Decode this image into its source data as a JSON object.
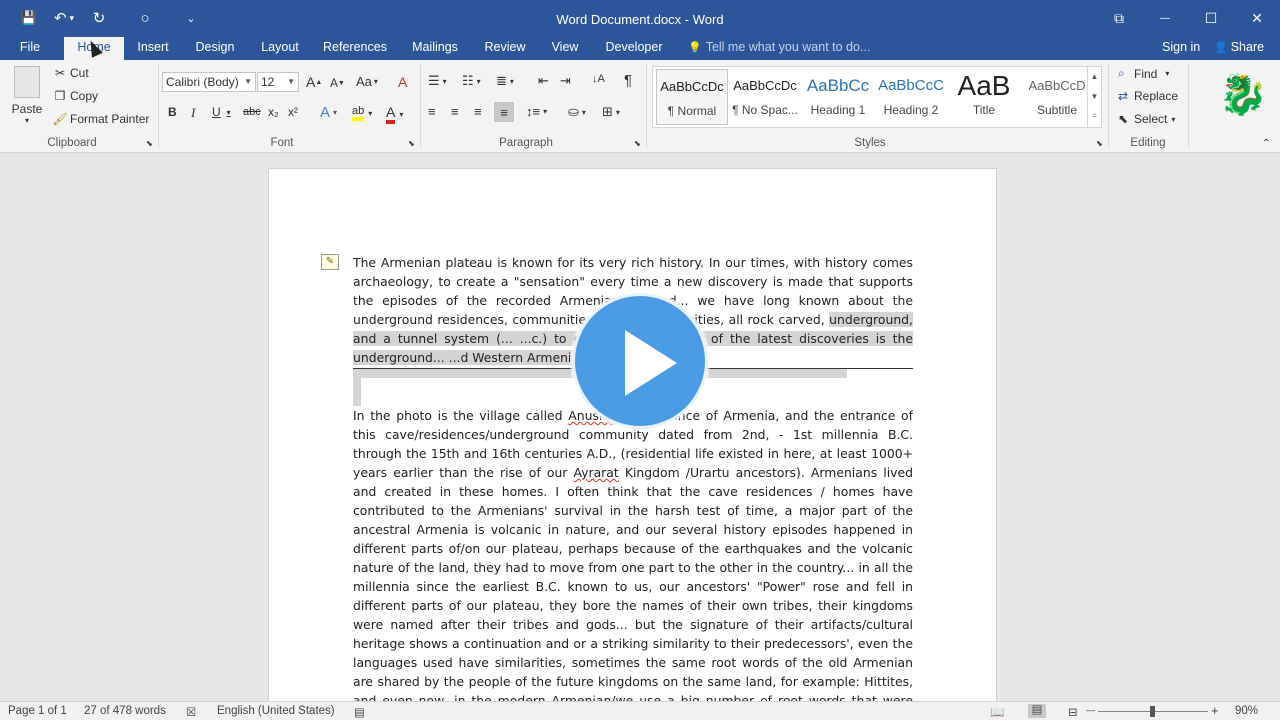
{
  "window": {
    "title": "Word Document.docx - Word"
  },
  "qat": {
    "save": "💾",
    "undo": "↶",
    "undo_dd": "▾",
    "redo": "↻",
    "touch": "○",
    "customize": "⌄"
  },
  "winctl": {
    "ribbon_opts": "⧉",
    "minimize": "—",
    "maximize": "☐",
    "close": "✕"
  },
  "tabs": [
    "File",
    "Home",
    "Insert",
    "Design",
    "Layout",
    "References",
    "Mailings",
    "Review",
    "View",
    "Developer"
  ],
  "tellme": {
    "icon": "💡",
    "placeholder": "Tell me what you want to do..."
  },
  "account": {
    "signin": "Sign in",
    "share": "Share",
    "share_icon": "👤"
  },
  "clipboard": {
    "paste": "Paste",
    "cut": "Cut",
    "copy": "Copy",
    "format_painter": "Format Painter",
    "label": "Clipboard"
  },
  "font": {
    "name": "Calibri (Body)",
    "size": "12",
    "label": "Font",
    "grow": "A",
    "shrink": "A",
    "case": "Aa",
    "clear": "A",
    "bold": "B",
    "italic": "I",
    "underline": "U",
    "strike": "abc",
    "sub": "x₂",
    "sup": "x²",
    "effects": "A",
    "highlight": "ab",
    "color": "A"
  },
  "paragraph": {
    "label": "Paragraph",
    "pilcrow": "¶",
    "sort": "↓A"
  },
  "styles": {
    "label": "Styles",
    "items": [
      {
        "preview": "AaBbCcDc",
        "name": "¶ Normal"
      },
      {
        "preview": "AaBbCcDc",
        "name": "¶ No Spac..."
      },
      {
        "preview": "AaBbCc",
        "name": "Heading 1"
      },
      {
        "preview": "AaBbCcC",
        "name": "Heading 2"
      },
      {
        "preview": "AaB",
        "name": "Title"
      },
      {
        "preview": "AaBbCcD",
        "name": "Subtitle"
      }
    ]
  },
  "editing": {
    "label": "Editing",
    "find": "Find",
    "replace": "Replace",
    "select": "Select"
  },
  "document": {
    "p1_a": "The Armenian plateau is known for its very rich history. In our times, with history comes archaeology, to create a \"sensation\" every time a new discovery is made that supports the episodes of the recorded Armenian n... ...d... we have long known about the underground residences, communitie... ... towns and cities, all rock carved,",
    "p1_b": "underground, and a tunnel system (... ...c.) to connect them... one of the latest discoveries is the underground... ...d Western Armenia...",
    "p2_a": "In the photo is the village called ",
    "p2_village": "Anushava",
    "p2_b": "... province of Armenia, and the entrance of this cave/residences/underground community dated from 2nd, - 1st millennia B.C. through the 15th and 16th centuries A.D., (residential life existed in here, at least 1000+ years earlier than the rise of our ",
    "p2_ayrarat": "Ayrarat",
    "p2_c": " Kingdom /Urartu ancestors). Armenians lived and created in these homes. I often think that the cave residences / homes have contributed to the Armenians' survival in the harsh test of time, a major part of the ancestral Armenia is volcanic in nature, and our several history episodes happened in different parts of/on our plateau, perhaps because of the earthquakes and the volcanic nature of the land, they had to move from one part to the other in the country... in all the millennia since the earliest B.C. known to us, our ancestors' \"Power\" rose and fell in different parts of our plateau, they bore the names of their own tribes, their kingdoms were named after their tribes and gods... but the signature of their artifacts/cultural heritage shows a continuation and or a striking similarity to their predecessors', even the languages used have similarities, sometimes the same root words of the old Armenian are shared by the people of the future kingdoms on the same land, for example: Hittites, and even now, in the modern Armenian/we use a big number of root words that were used by the Sumerians, the meaning of the Armenian root words are the same root words in the Sumerian, the modern Armenian is the"
  },
  "status": {
    "page": "Page 1 of 1",
    "words": "27 of 478 words",
    "language": "English (United States)",
    "zoom": "90%",
    "zoom_minus": "—",
    "zoom_plus": "+"
  },
  "colors": {
    "brand": "#2b579a",
    "play": "#4a9be4"
  }
}
